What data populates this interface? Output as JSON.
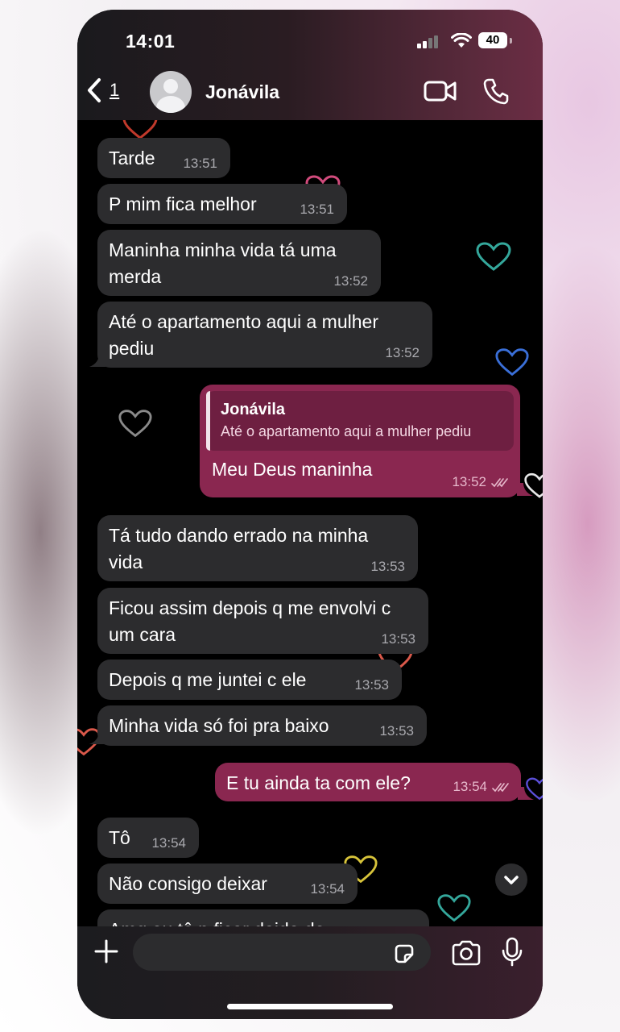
{
  "status_bar": {
    "time": "14:01",
    "battery": "40"
  },
  "header": {
    "back_count": "1",
    "contact_name": "Jonávila"
  },
  "messages": [
    {
      "text": "Tarde",
      "time": "13:51",
      "direction": "incoming"
    },
    {
      "text": "P mim fica melhor",
      "time": "13:51",
      "direction": "incoming"
    },
    {
      "text": "Maninha minha vida tá uma merda",
      "time": "13:52",
      "direction": "incoming"
    },
    {
      "text": "Até o apartamento aqui a mulher pediu",
      "time": "13:52",
      "direction": "incoming"
    },
    {
      "text": "Meu Deus maninha",
      "time": "13:52",
      "direction": "outgoing",
      "reply": {
        "name": "Jonávila",
        "text": "Até o apartamento aqui a mulher pediu"
      }
    },
    {
      "text": "Tá tudo dando errado na minha vida",
      "time": "13:53",
      "direction": "incoming"
    },
    {
      "text": "Ficou assim depois q me envolvi c um cara",
      "time": "13:53",
      "direction": "incoming"
    },
    {
      "text": "Depois q me juntei c ele",
      "time": "13:53",
      "direction": "incoming"
    },
    {
      "text": "Minha vida só foi pra baixo",
      "time": "13:53",
      "direction": "incoming"
    },
    {
      "text": "E tu ainda ta com ele?",
      "time": "13:54",
      "direction": "outgoing"
    },
    {
      "text": "Tô",
      "time": "13:54",
      "direction": "incoming"
    },
    {
      "text": "Não consigo deixar",
      "time": "13:54",
      "direction": "incoming"
    },
    {
      "text": "Amg eu tô p ficar doida da",
      "time": "",
      "direction": "incoming"
    }
  ],
  "composer": {
    "placeholder": ""
  },
  "colors": {
    "outgoing_bubble": "#8a2750",
    "incoming_bubble": "#2c2c2e",
    "header_accent": "#6b2d44"
  }
}
